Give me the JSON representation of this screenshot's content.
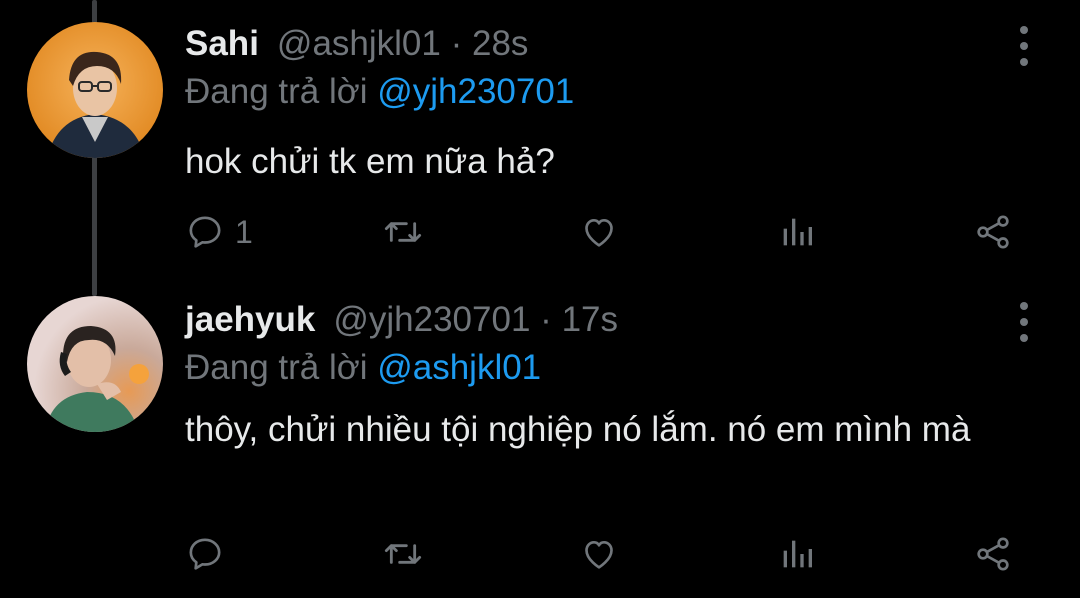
{
  "tweets": [
    {
      "name": "Sahi",
      "handle": "@ashjkl01",
      "separator": "·",
      "time": "28s",
      "replying_prefix": "Đang trả lời",
      "replying_to": "@yjh230701",
      "text": "hok chửi tk em nữa hả?",
      "reply_count": "1",
      "retweet_count": "",
      "like_count": "",
      "view_count": ""
    },
    {
      "name": "jaehyuk",
      "handle": "@yjh230701",
      "separator": "·",
      "time": "17s",
      "replying_prefix": "Đang trả lời",
      "replying_to": "@ashjkl01",
      "text": "thôy, chửi nhiều tội nghiệp nó lắm. nó em mình mà",
      "reply_count": "",
      "retweet_count": "",
      "like_count": "",
      "view_count": ""
    }
  ],
  "colors": {
    "background": "#000000",
    "text": "#e7e9ea",
    "muted": "#71767b",
    "mention": "#1d9bf0",
    "thread_line": "#3d3f42"
  },
  "icons": {
    "reply": "reply-icon",
    "retweet": "retweet-icon",
    "like": "heart-icon",
    "views": "analytics-icon",
    "share": "share-icon",
    "more": "more-options-icon"
  }
}
